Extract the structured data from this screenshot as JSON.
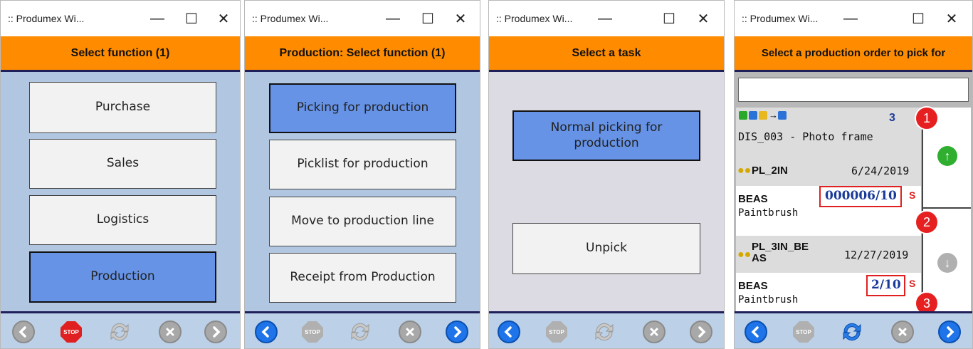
{
  "window_title": ":: Produmex Wi...",
  "controls": {
    "minimize": "—",
    "maximize": "☐",
    "close": "✕"
  },
  "screen1": {
    "header": "Select function (1)",
    "buttons": [
      "Purchase",
      "Sales",
      "Logistics",
      "Production"
    ],
    "selected": "Production"
  },
  "screen2": {
    "header": "Production: Select function (1)",
    "buttons": [
      "Picking for production",
      "Picklist for production",
      "Move to production line",
      "Receipt from Production"
    ],
    "selected": "Picking for production"
  },
  "screen3": {
    "header": "Select a task",
    "buttons": [
      "Normal picking for production",
      "Unpick"
    ],
    "selected": "Normal picking for production"
  },
  "screen4": {
    "header": "Select a production order to pick for",
    "search_value": "",
    "count": "3",
    "order_item": "DIS_003 - Photo frame",
    "lines": [
      {
        "code": "PL_2IN",
        "date": "6/24/2019",
        "type": "BEAS",
        "qty": "000006/10",
        "flag": "S",
        "desc": "Paintbrush"
      },
      {
        "code": "PL_3IN_BE AS",
        "date": "12/27/2019",
        "type": "BEAS",
        "qty": "2/10",
        "flag": "S",
        "desc": "Paintbrush"
      }
    ],
    "badges": [
      "1",
      "2",
      "3"
    ]
  },
  "footer": {
    "stop_label": "STOP"
  },
  "colors": {
    "header": "#ff8c00",
    "selected": "#6693e6",
    "nav_blue": "#1e74e8",
    "badge": "#e62020"
  }
}
